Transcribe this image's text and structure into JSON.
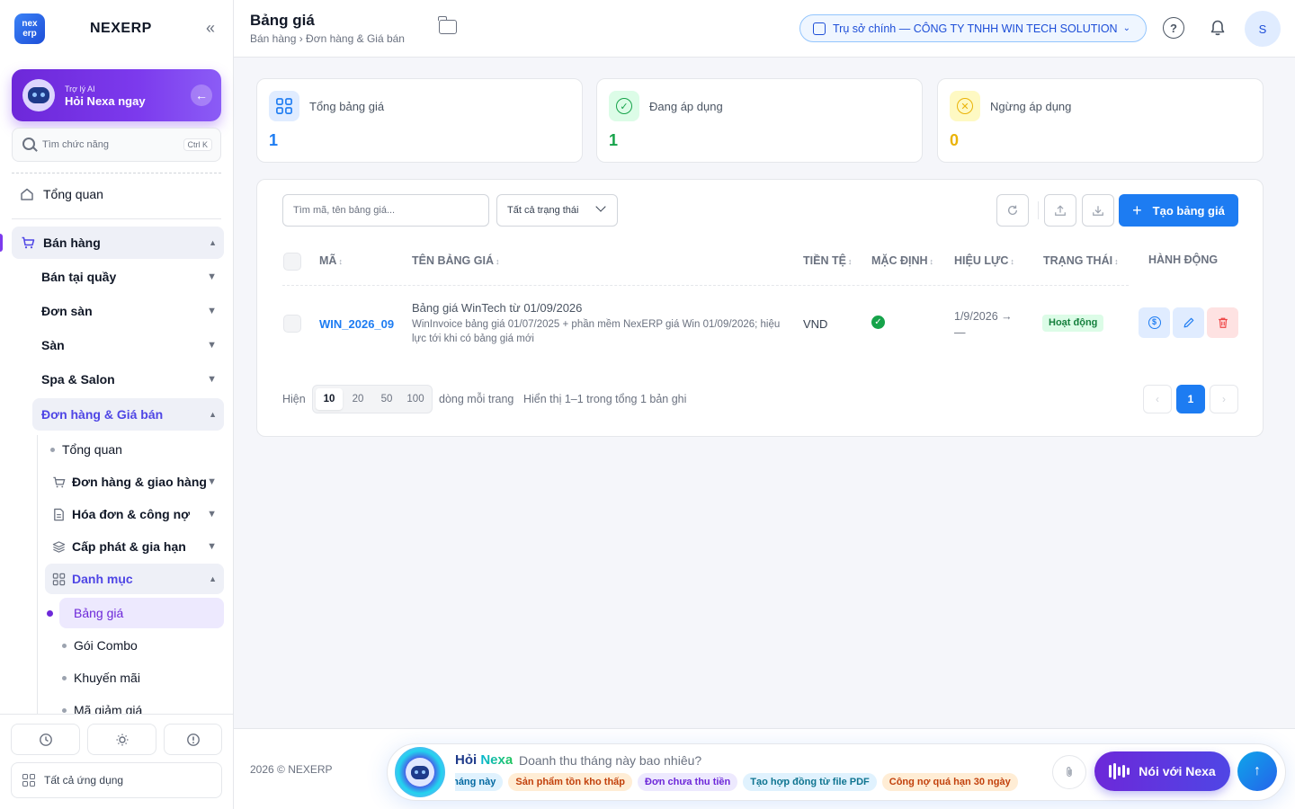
{
  "brand": {
    "logo_text": "nex erp",
    "name": "NEXERP",
    "collapse_glyph": "«"
  },
  "ai_card": {
    "subtitle": "Trợ lý AI",
    "title": "Hỏi Nexa ngay",
    "arrow": "←"
  },
  "side_search": {
    "placeholder": "Tìm chức năng",
    "shortcut": "Ctrl K"
  },
  "nav": {
    "overview": "Tổng quan",
    "sales": "Bán hàng",
    "pos": "Bán tại quầy",
    "marketplace_orders": "Đơn sàn",
    "marketplace": "Sàn",
    "spa": "Spa & Salon",
    "orders_prices": "Đơn hàng & Giá bán",
    "sub_overview": "Tổng quan",
    "orders_delivery": "Đơn hàng & giao hàng",
    "invoices_debt": "Hóa đơn & công nợ",
    "provision": "Cấp phát & gia hạn",
    "catalog": "Danh mục",
    "price_list": "Bảng giá",
    "combo": "Gói Combo",
    "promo": "Khuyến mãi",
    "coupon": "Mã giảm giá"
  },
  "side_bottom": {
    "all_apps": "Tất cả ứng dụng"
  },
  "header": {
    "title": "Bảng giá",
    "breadcrumb": "Bán hàng › Đơn hàng & Giá bán",
    "org": "Trụ sở chính — CÔNG TY TNHH WIN TECH SOLUTION",
    "help": "?",
    "avatar": "S"
  },
  "stats": [
    {
      "label": "Tổng bảng giá",
      "value": "1",
      "color": "#1d7cf2"
    },
    {
      "label": "Đang áp dụng",
      "value": "1",
      "color": "#16a34a"
    },
    {
      "label": "Ngừng áp dụng",
      "value": "0",
      "color": "#eab308"
    }
  ],
  "toolbar": {
    "search_placeholder": "Tìm mã, tên bảng giá...",
    "status_filter": "Tất cả trạng thái",
    "create_label": "Tạo bảng giá"
  },
  "table": {
    "columns": [
      "MÃ",
      "TÊN BẢNG GIÁ",
      "TIỀN TỆ",
      "MẶC ĐỊNH",
      "HIỆU LỰC",
      "TRẠNG THÁI",
      "HÀNH ĐỘNG"
    ],
    "sort_glyph": "↕",
    "rows": [
      {
        "code": "WIN_2026_09",
        "name": "Bảng giá WinTech từ 01/09/2026",
        "description": "WinInvoice bảng giá 01/07/2025 + phần mềm NexERP giá Win 01/09/2026; hiệu lực tới khi có bảng giá mới",
        "currency": "VND",
        "is_default": true,
        "validity_start": "1/9/2026 →",
        "validity_end": "—",
        "status": "Hoạt động"
      }
    ]
  },
  "pagination": {
    "show_label": "Hiện",
    "sizes": [
      "10",
      "20",
      "50",
      "100"
    ],
    "selected_size": "10",
    "per_page_label": "dòng mỗi trang",
    "summary": "Hiển thị 1–1 trong tổng 1 bản ghi",
    "current_page": "1"
  },
  "footer": {
    "copyright": "2026 © NEXERP",
    "ask_prefix": "Hỏi",
    "ask_brand": "Nexa",
    "ask_placeholder": "Doanh thu tháng này bao nhiêu?",
    "chips": [
      {
        "text": "Doanh thu tháng này",
        "bg": "#e0f2fe",
        "fg": "#0369a1"
      },
      {
        "text": "Sản phẩm tồn kho thấp",
        "bg": "#ffedd5",
        "fg": "#c2410c"
      },
      {
        "text": "Đơn chưa thu tiền",
        "bg": "#ede9fe",
        "fg": "#6d28d9"
      },
      {
        "text": "Tạo hợp đồng từ file PDF",
        "bg": "#e0f2fe",
        "fg": "#0e7490"
      },
      {
        "text": "Công nợ quá hạn 30 ngày",
        "bg": "#ffedd5",
        "fg": "#c2410c"
      }
    ],
    "talk_label": "Nói với Nexa",
    "send_glyph": "↑"
  }
}
